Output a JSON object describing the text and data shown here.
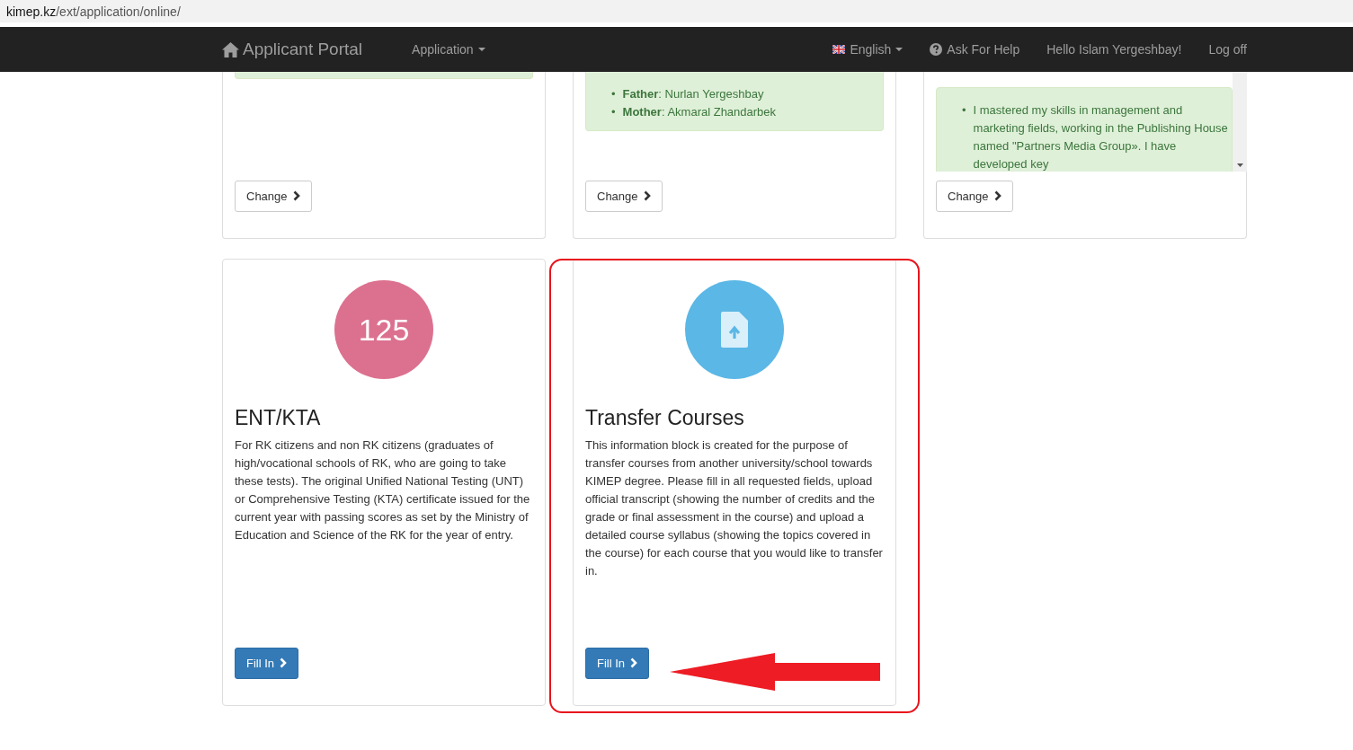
{
  "address_bar": {
    "host": "kimep.kz",
    "path": "/ext/application/online/"
  },
  "navbar": {
    "brand": "Applicant Portal",
    "menu": "Application",
    "language": "English",
    "help": "Ask For Help",
    "greeting": "Hello Islam Yergeshbay!",
    "logout": "Log off"
  },
  "top_cards": [
    {
      "kind": "plain",
      "button": "Change"
    },
    {
      "kind": "list",
      "items": [
        {
          "marker": "•",
          "text": "**Father**: Nurlan Yergeshbay"
        },
        {
          "marker": "•",
          "text": "**Mother**: Akmaral Zhandarbek"
        }
      ],
      "button": "Change"
    },
    {
      "kind": "scroll",
      "items": [
        {
          "marker": "•",
          "text": "I mastered my skills in management and marketing fields, working in the Publishing House named \"Partners Media Group». I have developed key"
        }
      ],
      "button": "Change"
    }
  ],
  "cards": [
    {
      "kind": "number",
      "badge": "125",
      "color": "#dc718f",
      "title": "ENT/KTA",
      "text": "For RK citizens and non RK citizens (graduates of high/vocational schools of RK, who are going to take these tests). The original Unified National Testing (UNT) or Comprehensive Testing (KTA) certificate issued for the current year with passing scores as set by the Ministry of Education and Science of the RK for the year of entry.",
      "button": "Fill In",
      "highlighted": false
    },
    {
      "kind": "upload",
      "color": "#5bb7e5",
      "title": "Transfer Courses",
      "text": "This information block is created for the purpose of transfer courses from another university/school towards KIMEP degree. Please fill in all requested fields, upload official transcript (showing the number of credits and the grade or final assessment in the course) and upload a detailed course syllabus (showing the topics covered in the course) for each course that you would like to transfer in.",
      "button": "Fill In",
      "highlighted": true
    }
  ]
}
